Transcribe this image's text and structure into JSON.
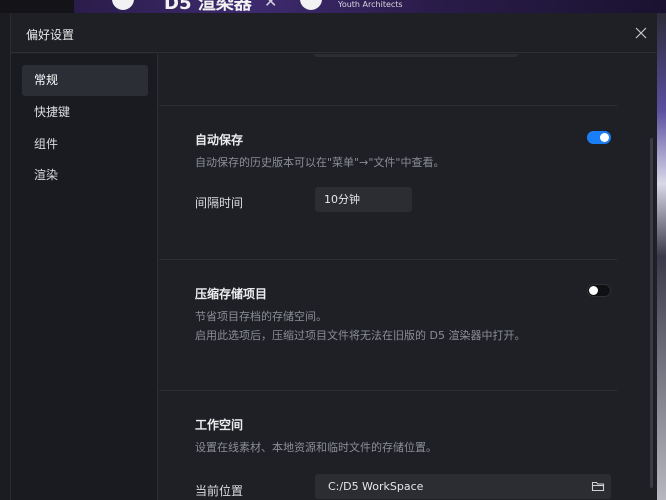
{
  "background": {
    "banner_brand_text": "D5 渲染器",
    "banner_separator": "✕",
    "banner_partner_text": "Youth Architects"
  },
  "dialog": {
    "title": "偏好设置",
    "close_icon": "close-icon"
  },
  "sidebar": {
    "items": [
      {
        "label": "常规",
        "active": true
      },
      {
        "label": "快捷键",
        "active": false
      },
      {
        "label": "组件",
        "active": false
      },
      {
        "label": "渲染",
        "active": false
      }
    ]
  },
  "sections": {
    "autosave": {
      "title": "自动保存",
      "desc": "自动保存的历史版本可以在\"菜单\"→\"文件\"中查看。",
      "enabled": true,
      "interval_label": "间隔时间",
      "interval_value": "10分钟"
    },
    "compress": {
      "title": "压缩存储项目",
      "desc_line1": "节省项目存档的存储空间。",
      "desc_line2": "启用此选项后，压缩过项目文件将无法在旧版的 D5 渲染器中打开。",
      "enabled": false
    },
    "workspace": {
      "title": "工作空间",
      "desc": "设置在线素材、本地资源和临时文件的存储位置。",
      "location_label": "当前位置",
      "location_value": "C:/D5 WorkSpace",
      "folder_icon": "folder-icon"
    }
  },
  "colors": {
    "accent": "#1a7ef7",
    "dialog_bg": "#1e2025",
    "sidebar_bg": "#1a1b20"
  }
}
